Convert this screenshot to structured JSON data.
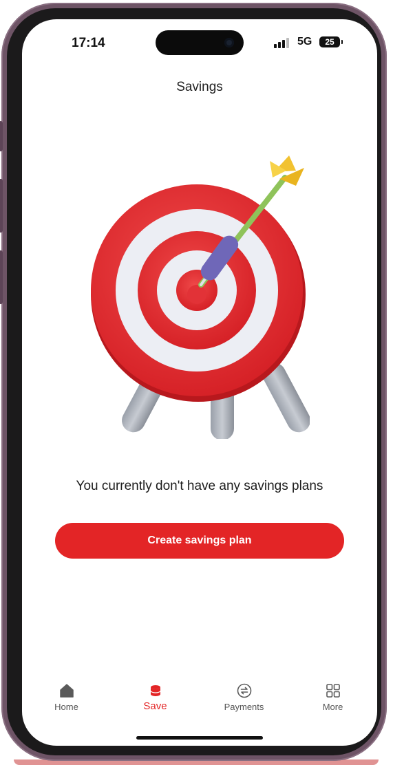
{
  "status_bar": {
    "time": "17:14",
    "network": "5G",
    "battery": "25"
  },
  "header": {
    "title": "Savings"
  },
  "illustration": {
    "icon": "target-with-dart-icon"
  },
  "empty_state": {
    "message": "You currently don't have any savings plans",
    "cta_label": "Create savings plan"
  },
  "tab_bar": {
    "items": [
      {
        "label": "Home",
        "icon": "home-icon",
        "active": false
      },
      {
        "label": "Save",
        "icon": "savings-coin-stack-icon",
        "active": true
      },
      {
        "label": "Payments",
        "icon": "payments-arrows-icon",
        "active": false
      },
      {
        "label": "More",
        "icon": "grid-more-icon",
        "active": false
      }
    ]
  },
  "colors": {
    "accent": "#e32526",
    "text": "#1c1c1c",
    "frame": "#6e5466"
  }
}
